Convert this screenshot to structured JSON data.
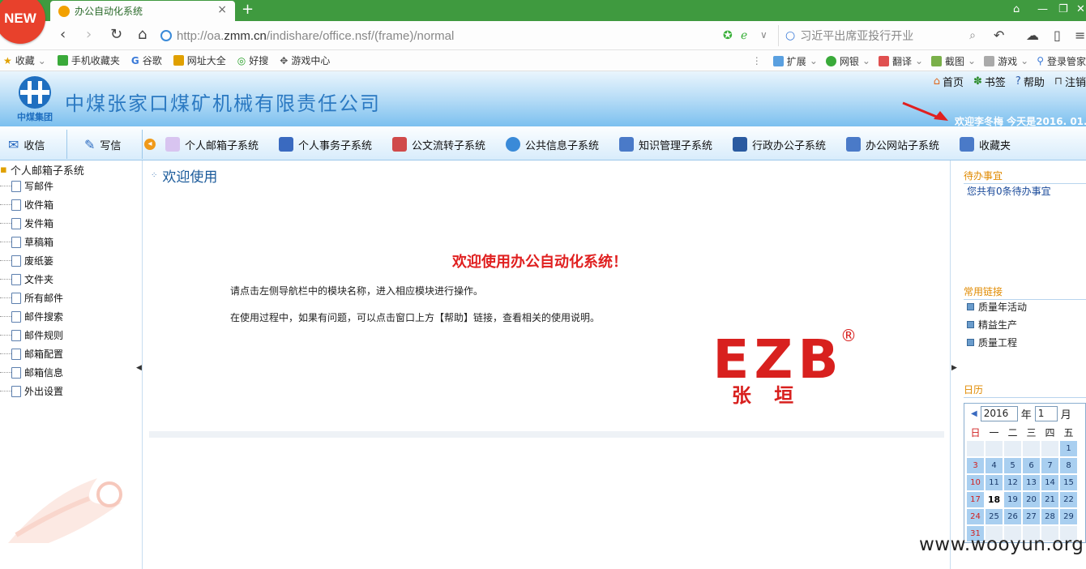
{
  "browser": {
    "new_badge": "NEW",
    "tab_title": "办公自动化系统",
    "tab_close": "×",
    "new_tab": "+",
    "url_domain_prefix": "http://oa.",
    "url_domain_bold": "zmm.cn",
    "url_path": "/indishare/office.nsf/(frame)/normal",
    "search_text": "习近平出席亚投行开业",
    "bookmarks": [
      "收藏",
      "手机收藏夹",
      "谷歌",
      "网址大全",
      "好搜",
      "游戏中心"
    ],
    "toolbar_right": [
      "扩展",
      "网银",
      "翻译",
      "截图",
      "游戏",
      "登录管家"
    ]
  },
  "header": {
    "logo_text": "中煤集团",
    "company_name": "中煤张家口煤矿机械有限责任公司",
    "top_links": [
      "首页",
      "书签",
      "帮助",
      "注销"
    ],
    "welcome": "欢迎李冬梅    今天是2016. 01."
  },
  "modnav": {
    "compose_inbox": "收信",
    "compose_write": "写信",
    "modules": [
      "个人邮箱子系统",
      "个人事务子系统",
      "公文流转子系统",
      "公共信息子系统",
      "知识管理子系统",
      "行政办公子系统",
      "办公网站子系统",
      "收藏夹"
    ]
  },
  "tree": {
    "root": "个人邮箱子系统",
    "items": [
      "写邮件",
      "收件箱",
      "发件箱",
      "草稿箱",
      "废纸篓",
      "文件夹",
      "所有邮件",
      "邮件搜索",
      "邮件规则",
      "邮箱配置",
      "邮箱信息",
      "外出设置"
    ]
  },
  "main": {
    "heading": "欢迎使用",
    "big_welcome": "欢迎使用办公自动化系统！",
    "line1": "请点击左侧导航栏中的模块名称，进入相应模块进行操作。",
    "line2": "在使用过程中，如果有问题，可以点击窗口上方【帮助】链接，查看相关的使用说明。",
    "logo_letters": "EZB",
    "logo_reg": "®",
    "logo_sub": "张 垣"
  },
  "right": {
    "todo_title": "待办事宜",
    "todo_text": "您共有0条待办事宜",
    "links_title": "常用链接",
    "links": [
      "质量年活动",
      "精益生产",
      "质量工程"
    ],
    "calendar_title": "日历",
    "calendar": {
      "year": "2016",
      "year_suffix": "年",
      "month": "1",
      "month_suffix": "月",
      "weekdays": [
        "日",
        "一",
        "二",
        "三",
        "四",
        "五"
      ],
      "rows": [
        [
          "",
          "",
          "",
          "",
          "",
          "1"
        ],
        [
          "3",
          "4",
          "5",
          "6",
          "7",
          "8"
        ],
        [
          "10",
          "11",
          "12",
          "13",
          "14",
          "15"
        ],
        [
          "17",
          "18",
          "19",
          "20",
          "21",
          "22"
        ],
        [
          "24",
          "25",
          "26",
          "27",
          "28",
          "29"
        ],
        [
          "31",
          "",
          "",
          "",
          "",
          ""
        ]
      ],
      "today": "18"
    }
  },
  "watermark": "www.wooyun.org",
  "colors": {
    "tabbar": "#3f9a3f",
    "company_blue": "#2b79c2",
    "welcome_red": "#e02020",
    "link_orange": "#e08a00",
    "calendar_cell": "#a9cff0"
  }
}
